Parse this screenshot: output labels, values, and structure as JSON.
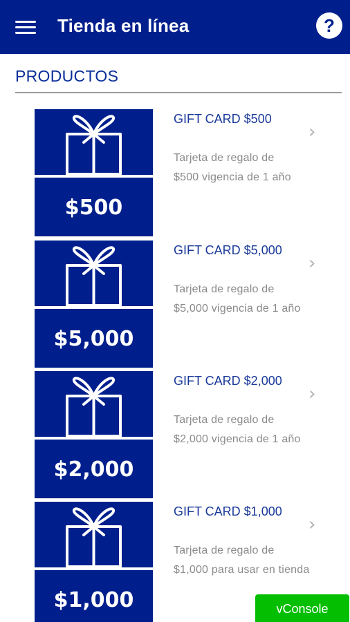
{
  "header": {
    "title": "Tienda en línea",
    "help_label": "?",
    "color": "#001f8c"
  },
  "section": {
    "title": "PRODUCTOS"
  },
  "products": [
    {
      "price_label": "$500",
      "title": "GIFT CARD $500",
      "desc_line1": "Tarjeta de regalo de",
      "desc_line2": "$500 vigencia de 1 año"
    },
    {
      "price_label": "$5,000",
      "title": "GIFT CARD $5,000",
      "desc_line1": "Tarjeta de regalo de",
      "desc_line2": "$5,000 vigencia de 1 año"
    },
    {
      "price_label": "$2,000",
      "title": "GIFT CARD $2,000",
      "desc_line1": "Tarjeta de regalo de",
      "desc_line2": "$2,000 vigencia de 1 año"
    },
    {
      "price_label": "$1,000",
      "title": "GIFT CARD $1,000",
      "desc_line1": "Tarjeta de regalo de",
      "desc_line2": "$1,000 para usar en tienda"
    }
  ],
  "vconsole": {
    "label": "vConsole",
    "color": "#04be02"
  },
  "icons": {
    "menu": "hamburger-icon",
    "help": "question-icon",
    "gift": "gift-box-icon",
    "chevron": "chevron-right-icon"
  }
}
